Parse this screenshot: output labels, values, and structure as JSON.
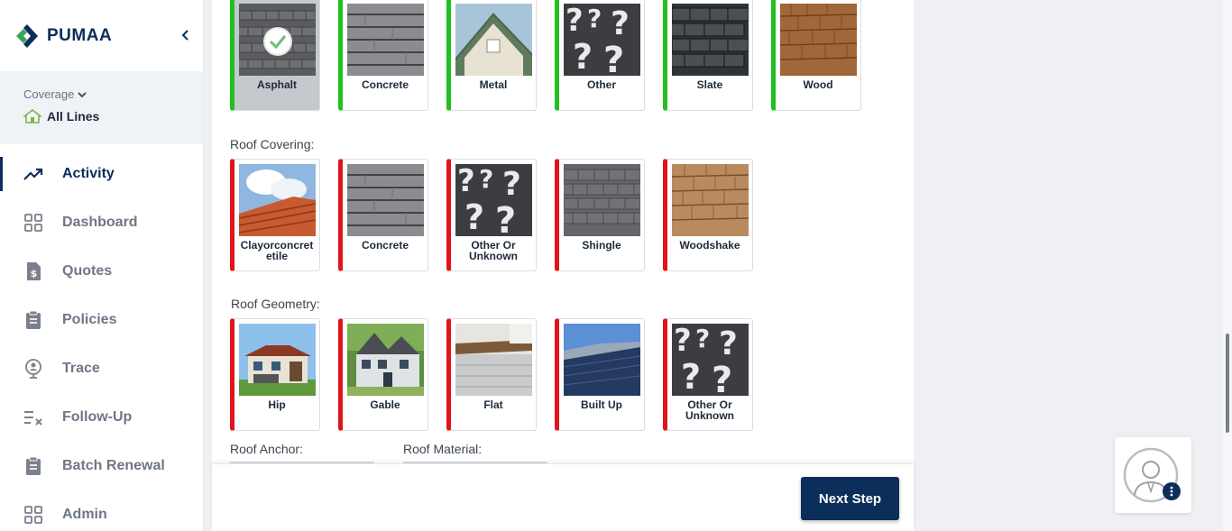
{
  "app": {
    "name": "PUMAA"
  },
  "coverage": {
    "label": "Coverage",
    "value": "All Lines"
  },
  "nav": [
    {
      "label": "Activity",
      "icon": "trending-up-icon",
      "active": true
    },
    {
      "label": "Dashboard",
      "icon": "grid-icon"
    },
    {
      "label": "Quotes",
      "icon": "dollar-document-icon"
    },
    {
      "label": "Policies",
      "icon": "clipboard-icon"
    },
    {
      "label": "Trace",
      "icon": "map-pin-person-icon"
    },
    {
      "label": "Follow-Up",
      "icon": "checklist-icon"
    },
    {
      "label": "Batch Renewal",
      "icon": "clipboard-icon"
    },
    {
      "label": "Admin",
      "icon": "grid-icon"
    }
  ],
  "roof_type": {
    "options": [
      {
        "label": "Asphalt",
        "selected": true
      },
      {
        "label": "Concrete"
      },
      {
        "label": "Metal"
      },
      {
        "label": "Other"
      },
      {
        "label": "Slate"
      },
      {
        "label": "Wood"
      }
    ]
  },
  "roof_covering": {
    "label": "Roof Covering:",
    "options": [
      {
        "label": "Clayorconcretetile"
      },
      {
        "label": "Concrete"
      },
      {
        "label": "Other Or Unknown"
      },
      {
        "label": "Shingle"
      },
      {
        "label": "Woodshake"
      }
    ]
  },
  "roof_geometry": {
    "label": "Roof Geometry:",
    "options": [
      {
        "label": "Hip"
      },
      {
        "label": "Gable"
      },
      {
        "label": "Flat"
      },
      {
        "label": "Built Up"
      },
      {
        "label": "Other Or Unknown"
      }
    ]
  },
  "roof_anchor": {
    "label": "Roof Anchor:"
  },
  "roof_material": {
    "label": "Roof Material:"
  },
  "footer": {
    "next_label": "Next Step"
  },
  "colors": {
    "brand": "#0b2e5a",
    "accent_green": "#20c020",
    "accent_red": "#e0141b"
  }
}
